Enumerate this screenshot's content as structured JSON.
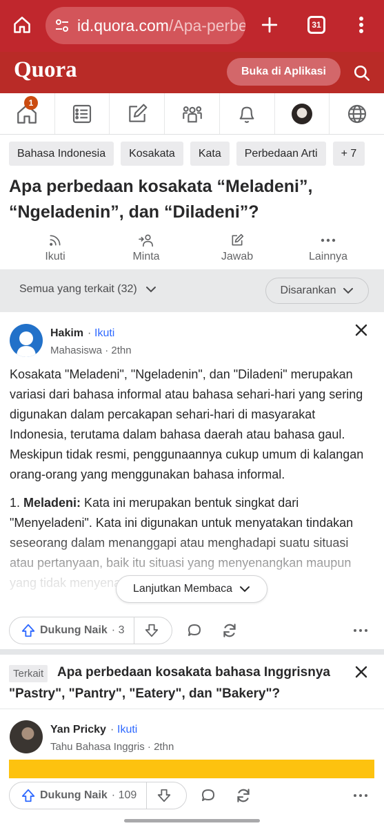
{
  "browser": {
    "url_main": "id.quora.com",
    "url_path": "/Apa-perbe",
    "tab_count": "31",
    "icons": [
      "home-icon",
      "site-settings-icon",
      "new-tab-icon",
      "tabs-icon",
      "more-vert-icon"
    ]
  },
  "header": {
    "logo": "Quora",
    "open_app_label": "Buka di Aplikasi",
    "search_icon": "search-icon"
  },
  "nav": {
    "notification_count": "1",
    "items": [
      "home",
      "answer-feed",
      "write",
      "spaces",
      "notifications",
      "profile",
      "language"
    ]
  },
  "topics": [
    "Bahasa Indonesia",
    "Kosakata",
    "Kata",
    "Perbedaan Arti",
    "+ 7"
  ],
  "question": {
    "title": "Apa perbedaan kosakata “Meladeni”, “Ngeladenin”, dan “Diladeni”?"
  },
  "actions": {
    "follow": "Ikuti",
    "request": "Minta",
    "answer": "Jawab",
    "more": "Lainnya"
  },
  "filter": {
    "related_label": "Semua yang terkait (32)",
    "sort_label": "Disarankan"
  },
  "answer": {
    "author": "Hakim",
    "dot": "·",
    "follow": "Ikuti",
    "meta": "Mahasiswa · 2thn",
    "para1": "Kosakata \"Meladeni\", \"Ngeladenin\", dan \"Diladeni\" merupakan variasi dari bahasa informal atau bahasa sehari-hari yang sering digunakan dalam percakapan sehari-hari di masyarakat Indonesia, terutama dalam bahasa daerah atau bahasa gaul. Meskipun tidak resmi, penggunaannya cukup umum di kalangan orang-orang yang menggunakan bahasa informal.",
    "point_prefix": "1. ",
    "point_term": "Meladeni:",
    "point_text": " Kata ini merupakan bentuk singkat dari \"Menyeladeni\". Kata ini digunakan untuk menyatakan tindakan seseorang dalam menanggapi atau menghadapi suatu situasi atau pertanyaan, baik itu situasi yang menyenangkan maupun yang tidak menyenangkan.",
    "continue_label": "Lanjutkan Membaca",
    "upvote_label": "Dukung Naik",
    "upvote_count": "· 3"
  },
  "related": {
    "tag": "Terkait",
    "question": "Apa perbedaan kosakata bahasa Inggrisnya \"Pastry\", \"Pantry\", \"Eatery\", dan \"Bakery\"?",
    "author": "Yan Pricky",
    "dot": "·",
    "follow": "Ikuti",
    "meta": "Tahu Bahasa Inggris · 2thn",
    "upvote_label": "Dukung Naik",
    "upvote_count": "· 109"
  },
  "colors": {
    "browser_red": "#c0272d",
    "quora_red": "#b92b27",
    "link_blue": "#2e69ff",
    "upvote_blue": "#2e69ff",
    "highlight_yellow": "#fdc20f"
  }
}
